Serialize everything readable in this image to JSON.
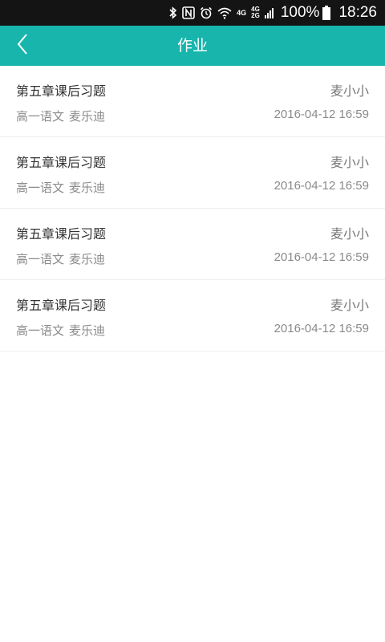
{
  "status_bar": {
    "network_4g": "4G",
    "network_4g_small": "4G",
    "network_2g_small": "2G",
    "battery": "100%",
    "time": "18:26"
  },
  "header": {
    "title": "作业",
    "back_icon": "chevron-left-icon"
  },
  "colors": {
    "header_bg": "#17b5ac",
    "status_bg": "#141414"
  },
  "assignments": [
    {
      "title": "第五章课后习题",
      "author": "麦小小",
      "subject": "高一语文",
      "teacher": "麦乐迪",
      "time": "2016-04-12 16:59"
    },
    {
      "title": "第五章课后习题",
      "author": "麦小小",
      "subject": "高一语文",
      "teacher": "麦乐迪",
      "time": "2016-04-12 16:59"
    },
    {
      "title": "第五章课后习题",
      "author": "麦小小",
      "subject": "高一语文",
      "teacher": "麦乐迪",
      "time": "2016-04-12 16:59"
    },
    {
      "title": "第五章课后习题",
      "author": "麦小小",
      "subject": "高一语文",
      "teacher": "麦乐迪",
      "time": "2016-04-12 16:59"
    }
  ]
}
